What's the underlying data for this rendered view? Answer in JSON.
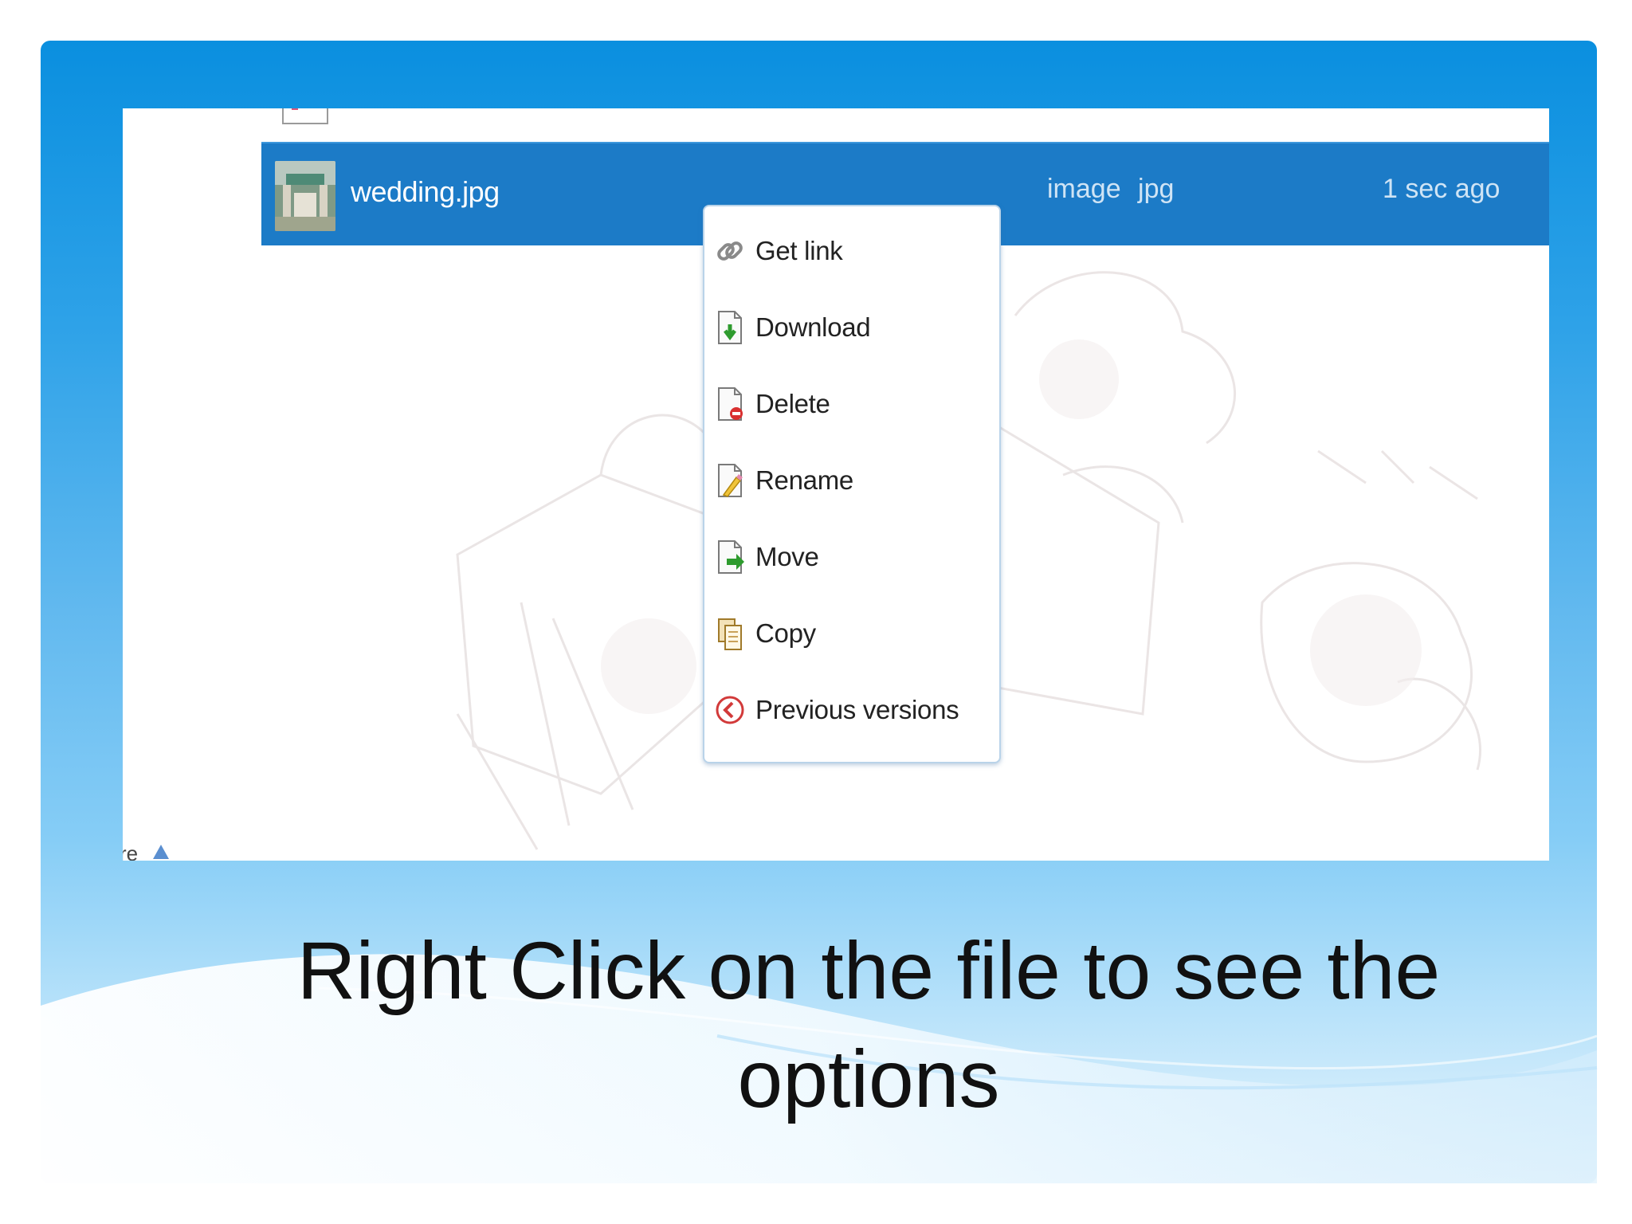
{
  "file_row": {
    "name": "wedding.jpg",
    "type": "image  jpg",
    "time": "1 sec ago"
  },
  "context_menu": {
    "items": [
      {
        "label": "Get link",
        "icon": "chain-link-icon"
      },
      {
        "label": "Download",
        "icon": "download-icon"
      },
      {
        "label": "Delete",
        "icon": "delete-icon"
      },
      {
        "label": "Rename",
        "icon": "rename-icon"
      },
      {
        "label": "Move",
        "icon": "move-icon"
      },
      {
        "label": "Copy",
        "icon": "copy-icon"
      },
      {
        "label": "Previous versions",
        "icon": "previous-versions-icon"
      }
    ]
  },
  "partial_label": "re",
  "caption": "Right Click on the file to see the options",
  "colors": {
    "slide_blue": "#0a8fdf",
    "selected_row": "#1c7bc7",
    "menu_border": "#b9d3e9"
  }
}
